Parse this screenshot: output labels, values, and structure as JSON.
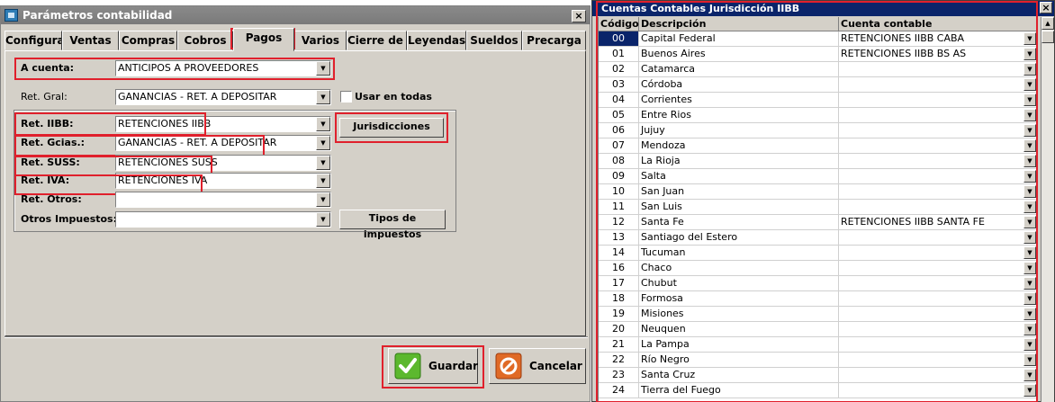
{
  "left_window": {
    "title": "Parámetros contabilidad",
    "close_glyph": "×",
    "tabs": [
      {
        "label": "Configurac"
      },
      {
        "label": "Ventas"
      },
      {
        "label": "Compras"
      },
      {
        "label": "Cobros"
      },
      {
        "label": "Pagos"
      },
      {
        "label": "Varios"
      },
      {
        "label": "Cierre de E"
      },
      {
        "label": "Leyendas"
      },
      {
        "label": "Sueldos"
      },
      {
        "label": "Precarga"
      }
    ],
    "active_tab": "Pagos",
    "fields": {
      "a_cuenta": {
        "label": "A cuenta:",
        "value": "ANTICIPOS A PROVEEDORES"
      },
      "ret_gral": {
        "label": "Ret. Gral:",
        "value": "GANANCIAS - RET. A DEPOSITAR"
      },
      "usar_en_todas": {
        "label": "Usar en todas",
        "checked": false
      },
      "ret_iibb": {
        "label": "Ret. IIBB:",
        "value": "RETENCIONES IIBB"
      },
      "ret_gcias": {
        "label": "Ret. Gcias.:",
        "value": "GANANCIAS - RET. A DEPOSITAR"
      },
      "ret_suss": {
        "label": "Ret. SUSS:",
        "value": "RETENCIONES SUSS"
      },
      "ret_iva": {
        "label": "Ret. IVA:",
        "value": "RETENCIONES IVA"
      },
      "ret_otros": {
        "label": "Ret. Otros:",
        "value": ""
      },
      "otros_impuestos": {
        "label": "Otros Impuestos:",
        "value": ""
      }
    },
    "buttons": {
      "jurisdicciones": "Jurisdicciones",
      "tipos_impuestos": "Tipos de impuestos",
      "guardar": "Guardar",
      "cancelar": "Cancelar"
    },
    "icons": {
      "save": "check-icon",
      "cancel": "cancel-icon",
      "dropdown": "chevron-down-icon"
    },
    "colors": {
      "highlight": "#e0202c",
      "save_icon": "#5cb82e",
      "cancel_icon": "#e06a26"
    }
  },
  "right_window": {
    "title": "Cuentas Contables Jurisdicción IIBB",
    "close_glyph": "×",
    "columns": [
      "Código",
      "Descripción",
      "Cuenta contable"
    ],
    "selected_code": "00",
    "rows": [
      {
        "code": "00",
        "desc": "Capital Federal",
        "account": "RETENCIONES IIBB CABA"
      },
      {
        "code": "01",
        "desc": "Buenos Aires",
        "account": "RETENCIONES IIBB BS AS"
      },
      {
        "code": "02",
        "desc": "Catamarca",
        "account": ""
      },
      {
        "code": "03",
        "desc": "Córdoba",
        "account": ""
      },
      {
        "code": "04",
        "desc": "Corrientes",
        "account": ""
      },
      {
        "code": "05",
        "desc": "Entre Rios",
        "account": ""
      },
      {
        "code": "06",
        "desc": "Jujuy",
        "account": ""
      },
      {
        "code": "07",
        "desc": "Mendoza",
        "account": ""
      },
      {
        "code": "08",
        "desc": "La Rioja",
        "account": ""
      },
      {
        "code": "09",
        "desc": "Salta",
        "account": ""
      },
      {
        "code": "10",
        "desc": "San Juan",
        "account": ""
      },
      {
        "code": "11",
        "desc": "San Luis",
        "account": ""
      },
      {
        "code": "12",
        "desc": "Santa Fe",
        "account": "RETENCIONES IIBB SANTA FE"
      },
      {
        "code": "13",
        "desc": "Santiago del Estero",
        "account": ""
      },
      {
        "code": "14",
        "desc": "Tucuman",
        "account": ""
      },
      {
        "code": "16",
        "desc": "Chaco",
        "account": ""
      },
      {
        "code": "17",
        "desc": "Chubut",
        "account": ""
      },
      {
        "code": "18",
        "desc": "Formosa",
        "account": ""
      },
      {
        "code": "19",
        "desc": "Misiones",
        "account": ""
      },
      {
        "code": "20",
        "desc": "Neuquen",
        "account": ""
      },
      {
        "code": "21",
        "desc": "La Pampa",
        "account": ""
      },
      {
        "code": "22",
        "desc": "Río Negro",
        "account": ""
      },
      {
        "code": "23",
        "desc": "Santa Cruz",
        "account": ""
      },
      {
        "code": "24",
        "desc": "Tierra del Fuego",
        "account": ""
      }
    ],
    "colors": {
      "title_bar": "#0a246a",
      "highlight": "#e0202c",
      "selection": "#0a246a"
    }
  }
}
